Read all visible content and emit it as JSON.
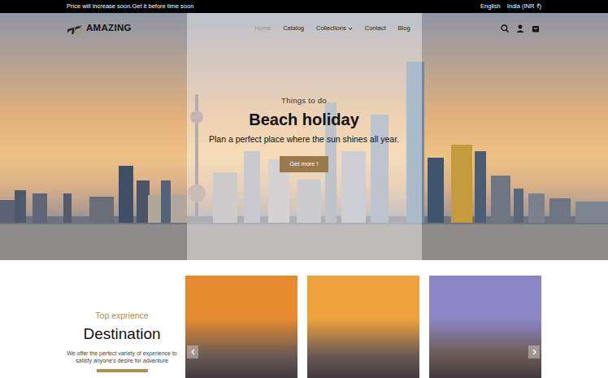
{
  "topbar": {
    "announcement": "Price will increase soon.Get it before time soon",
    "language": "English",
    "currency": "India (INR ₹)"
  },
  "logo": {
    "text": "AMAZING"
  },
  "nav": [
    {
      "label": "Home",
      "selected": true,
      "has_menu": false
    },
    {
      "label": "Catalog",
      "selected": false,
      "has_menu": false
    },
    {
      "label": "Collections",
      "selected": false,
      "has_menu": true
    },
    {
      "label": "Contact",
      "selected": false,
      "has_menu": false
    },
    {
      "label": "Blog",
      "selected": false,
      "has_menu": false
    }
  ],
  "hero": {
    "eyebrow": "Things to do",
    "title": "Beach holiday",
    "text": "Plan a perfect place where the sun shines all year.",
    "button": "Get more !"
  },
  "destinations": {
    "eyebrow": "Top exprience",
    "title": "Destination",
    "text": "We offer the perfect variety of experience to satisfy anyone's desire for adventure",
    "cards": [
      {
        "color": "#e58a2e"
      },
      {
        "color": "#eea23d"
      },
      {
        "color": "#8c86c6"
      }
    ]
  }
}
